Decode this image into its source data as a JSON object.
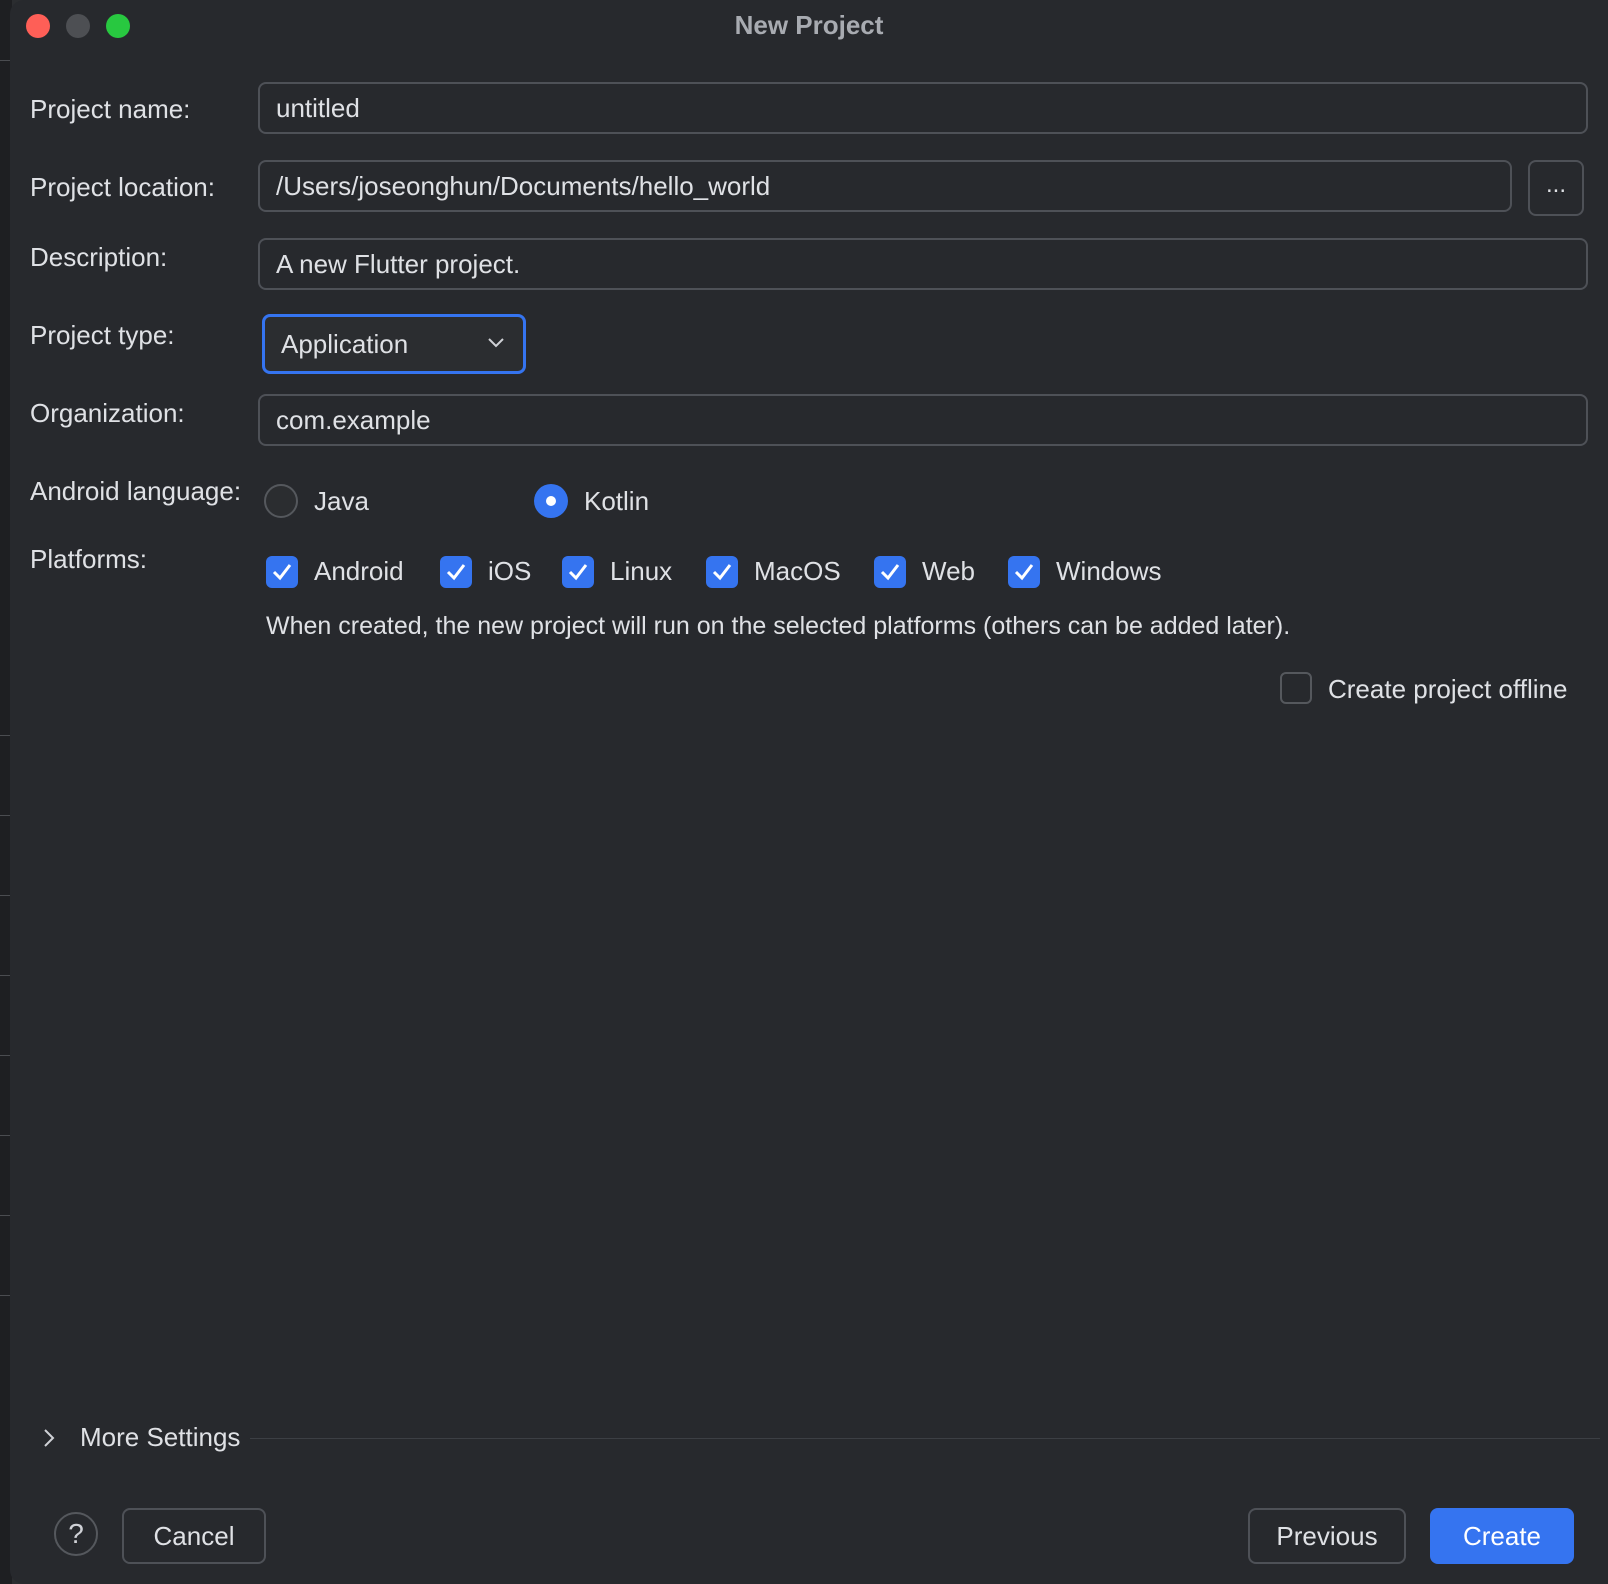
{
  "window": {
    "title": "New Project"
  },
  "form": {
    "project_name_label": "Project name:",
    "project_name_value": "untitled",
    "project_location_label": "Project location:",
    "project_location_value": "/Users/joseonghun/Documents/hello_world",
    "browse_button_label": "...",
    "description_label": "Description:",
    "description_value": "A new Flutter project.",
    "project_type_label": "Project type:",
    "project_type_value": "Application",
    "organization_label": "Organization:",
    "organization_value": "com.example",
    "android_language_label": "Android language:",
    "language_options": [
      {
        "label": "Java",
        "selected": false
      },
      {
        "label": "Kotlin",
        "selected": true
      }
    ],
    "platforms_label": "Platforms:",
    "platforms": [
      {
        "label": "Android",
        "checked": true
      },
      {
        "label": "iOS",
        "checked": true
      },
      {
        "label": "Linux",
        "checked": true
      },
      {
        "label": "MacOS",
        "checked": true
      },
      {
        "label": "Web",
        "checked": true
      },
      {
        "label": "Windows",
        "checked": true
      }
    ],
    "platforms_hint": "When created, the new project will run on the selected platforms (others can be added later).",
    "offline_label": "Create project offline",
    "offline_checked": false
  },
  "more_settings": {
    "label": "More Settings"
  },
  "footer": {
    "help_label": "?",
    "cancel_label": "Cancel",
    "previous_label": "Previous",
    "create_label": "Create"
  },
  "colors": {
    "accent": "#3574f0",
    "background": "#27292d",
    "close": "#fe5f57",
    "maximize": "#28c840"
  }
}
